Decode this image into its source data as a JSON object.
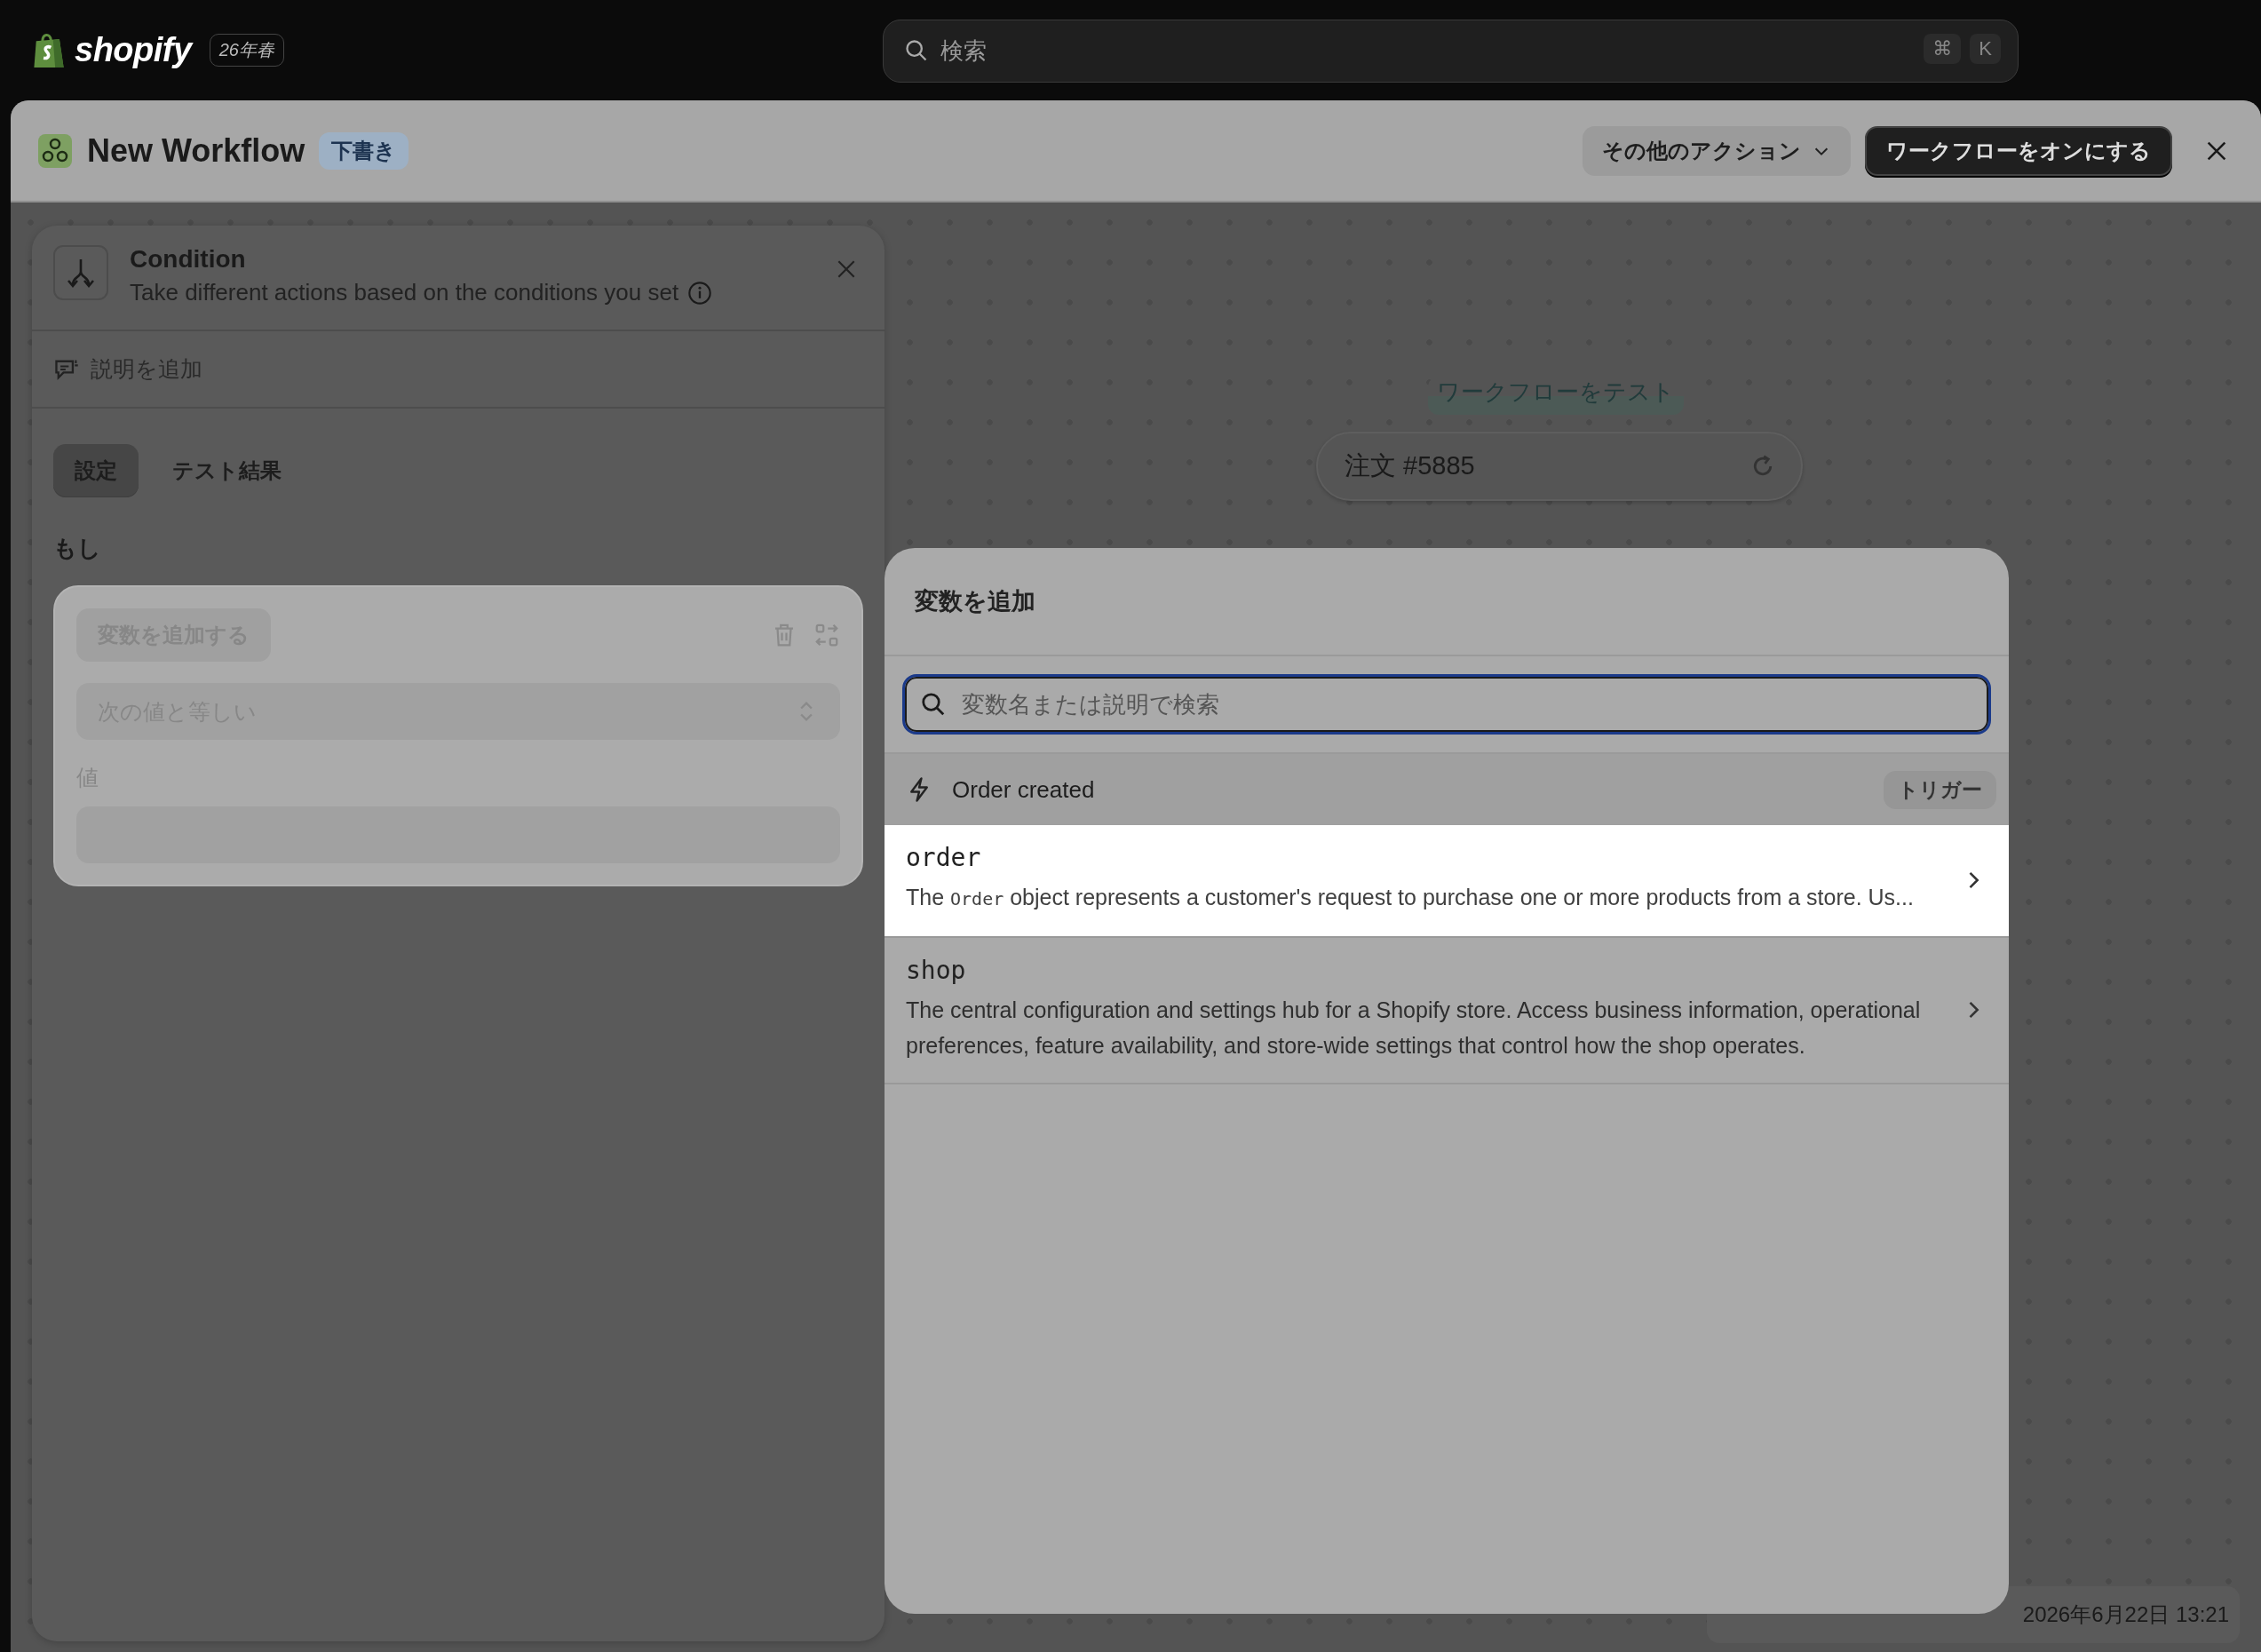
{
  "topbar": {
    "logo": "shopify",
    "edition": "26年春",
    "search": {
      "placeholder": "検索"
    },
    "shortcut": [
      "⌘",
      "K"
    ]
  },
  "header": {
    "title": "New Workflow",
    "badge": "下書き",
    "buttons": [
      {
        "label": "その他のアクション",
        "kind": "menu"
      },
      {
        "label": "ワークフローをオンにする",
        "kind": "primary"
      }
    ]
  },
  "panel": {
    "title": "Condition",
    "subtitle": "Take different actions based on the conditions you set",
    "add_description": "説明を追加",
    "tabs": [
      {
        "label": "設定",
        "selected": true
      },
      {
        "label": "テスト結果",
        "selected": false
      }
    ],
    "section_label": "もし",
    "condition": {
      "variable_button": "変数を追加する",
      "operator": "次の値と等しい",
      "value_label": "値"
    }
  },
  "canvas": {
    "node_label": "ワークフローをテスト",
    "test_order": "注文 #5885",
    "timestamp": "2026年6月22日 13:21"
  },
  "modal": {
    "title": "変数を追加",
    "search": {
      "placeholder": "変数名または説明で検索"
    },
    "group": {
      "title": "Order created",
      "tag": "トリガー"
    },
    "items": [
      {
        "name": "order",
        "selected": true,
        "description": [
          {
            "kind": "text",
            "text": "The "
          },
          {
            "kind": "code",
            "text": "Order"
          },
          {
            "kind": "text",
            "text": " object represents a customer's request to purchase one or more products from a store. Us..."
          }
        ]
      },
      {
        "name": "shop",
        "selected": false,
        "description": [
          {
            "kind": "text",
            "text": "The central configuration and settings hub for a Shopify store. Access business information, operational preferences, feature availability, and store-wide settings that control how the shop operates."
          }
        ]
      }
    ]
  }
}
